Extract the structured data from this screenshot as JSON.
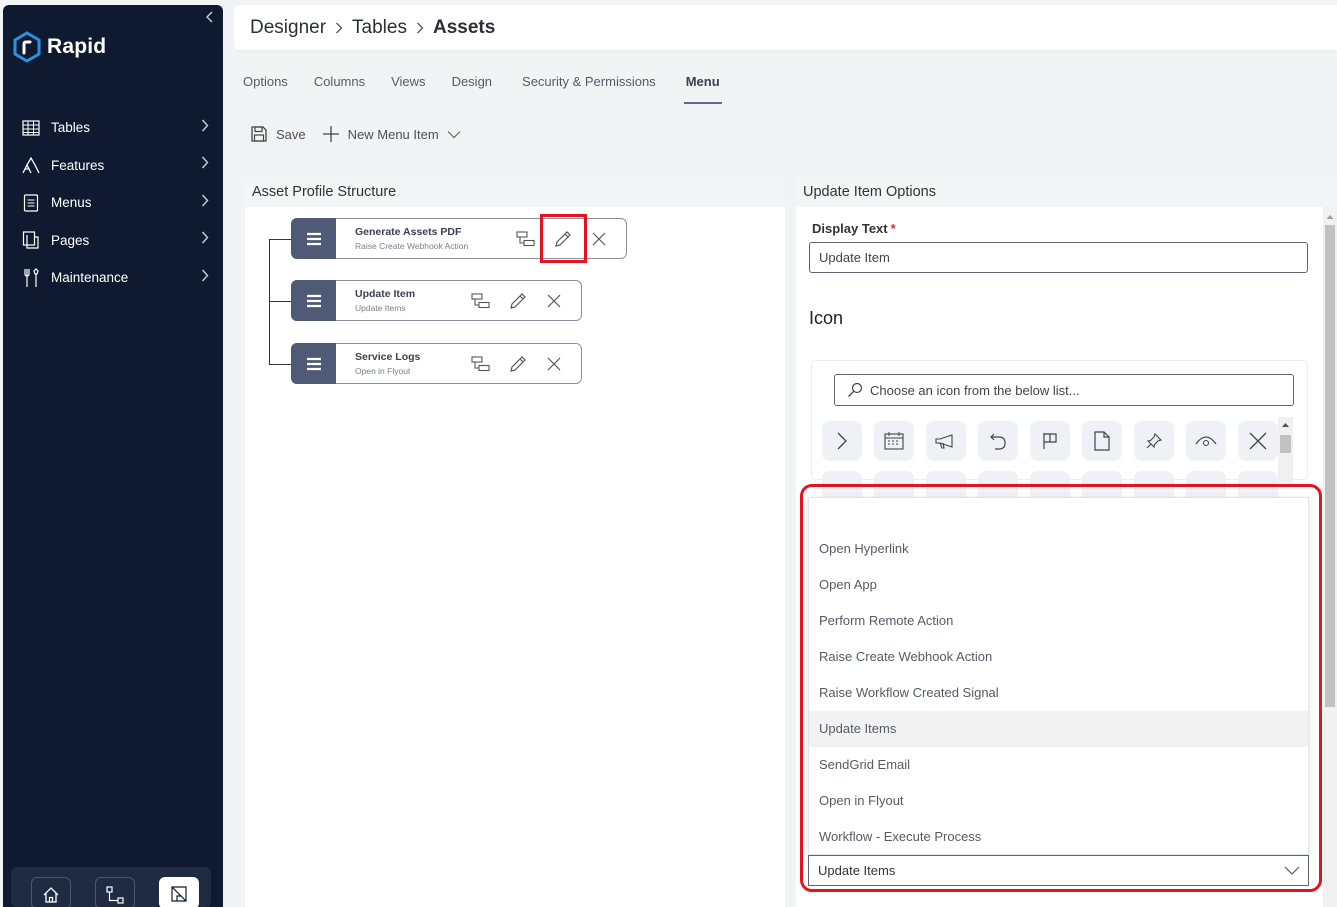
{
  "sidebar": {
    "logo_text": "Rapid",
    "items": [
      {
        "label": "Tables",
        "icon": "table-icon"
      },
      {
        "label": "Features",
        "icon": "features-icon"
      },
      {
        "label": "Menus",
        "icon": "menu-list-icon"
      },
      {
        "label": "Pages",
        "icon": "pages-icon"
      },
      {
        "label": "Maintenance",
        "icon": "wrench-icon"
      }
    ],
    "bottom": [
      "home-icon",
      "flow-icon",
      "designer-icon"
    ]
  },
  "breadcrumb": [
    "Designer",
    "Tables",
    "Assets"
  ],
  "tabs": [
    "Options",
    "Columns",
    "Views",
    "Design",
    "Security & Permissions",
    "Menu"
  ],
  "active_tab": "Menu",
  "toolbar": {
    "save": "Save",
    "new_item": "New Menu Item"
  },
  "left_panel": {
    "title": "Asset Profile Structure",
    "items": [
      {
        "title": "Generate Assets PDF",
        "subtitle": "Raise Create Webhook Action"
      },
      {
        "title": "Update Item",
        "subtitle": "Update Items"
      },
      {
        "title": "Service Logs",
        "subtitle": "Open in Flyout"
      }
    ]
  },
  "right_panel": {
    "title": "Update Item Options",
    "display_text_label": "Display Text",
    "required_mark": "*",
    "display_text_value": "Update Item",
    "icon_heading": "Icon",
    "icon_search_placeholder": "Choose an icon from the below list...",
    "icons": [
      "chevron-right-icon",
      "calendar-icon",
      "megaphone-icon",
      "undo-icon",
      "flag-icon",
      "file-icon",
      "pin-icon",
      "eye-icon",
      "close-icon"
    ],
    "action_options": [
      "",
      "Open Hyperlink",
      "Open App",
      "Perform Remote Action",
      "Raise Create Webhook Action",
      "Raise Workflow Created Signal",
      "Update Items",
      "SendGrid Email",
      "Open in Flyout",
      "Workflow - Execute Process"
    ],
    "action_selected": "Update Items"
  },
  "colors": {
    "sidebar_bg": "#0f1a30",
    "accent": "#4f5a76",
    "highlight": "#e3141f",
    "logo": "#2c8fe0"
  }
}
